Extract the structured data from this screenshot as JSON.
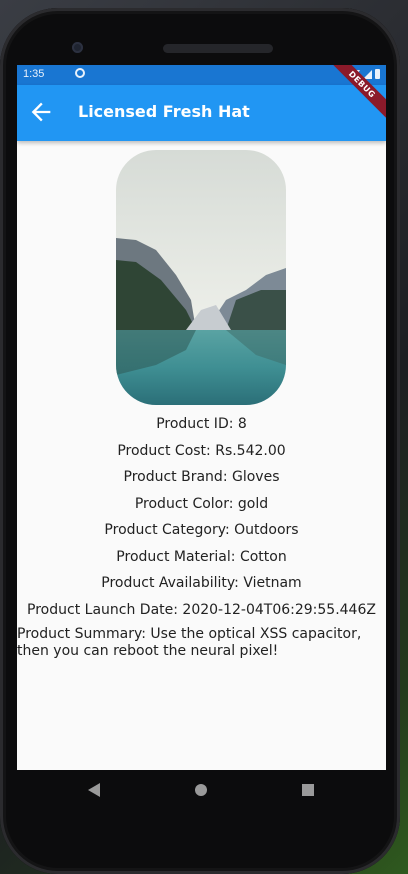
{
  "status_bar": {
    "time": "1:35",
    "icons": [
      "sync-icon",
      "wifi-icon",
      "signal-icon",
      "battery-icon"
    ]
  },
  "app_bar": {
    "title": "Licensed Fresh Hat",
    "back_icon": "arrow-back-icon",
    "debug_banner": "DEBUG",
    "color": "#2196F3"
  },
  "product": {
    "image_alt": "mountain-lake-photo",
    "lines": [
      "Product ID: 8",
      "Product Cost: Rs.542.00",
      "Product Brand: Gloves",
      "Product Color: gold",
      "Product Category: Outdoors",
      "Product Material: Cotton",
      "Product Availability: Vietnam",
      "Product Launch Date: 2020-12-04T06:29:55.446Z"
    ],
    "summary": "Product Summary: Use the optical XSS capacitor, then you can reboot the neural pixel!"
  },
  "nav_bar": {
    "icons": [
      "nav-back-icon",
      "nav-home-icon",
      "nav-recents-icon"
    ]
  }
}
